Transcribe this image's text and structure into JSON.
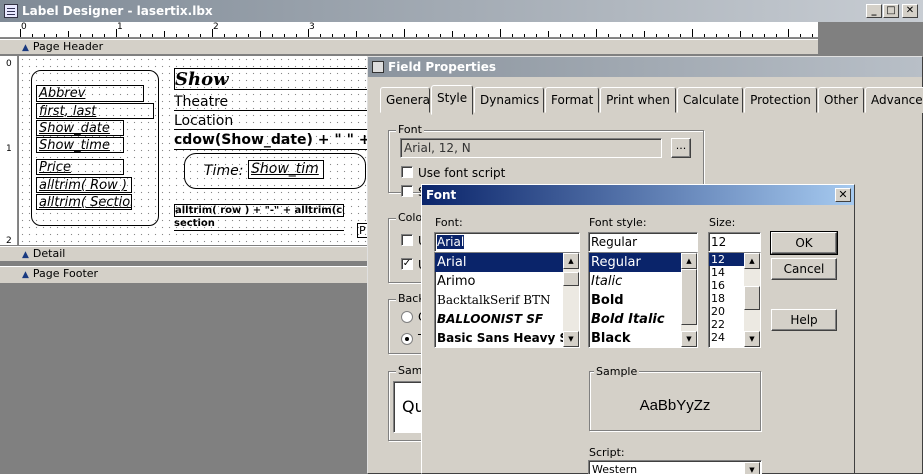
{
  "window": {
    "title": "Label Designer - lasertix.lbx",
    "min_glyph": "_",
    "max_glyph": "□",
    "close_glyph": "✕"
  },
  "ruler": {
    "marks": [
      "0",
      "1",
      "2",
      "3"
    ]
  },
  "vruler": {
    "marks": [
      "0",
      "1",
      "2"
    ]
  },
  "bands": {
    "header": "Page Header",
    "detail": "Detail",
    "footer": "Page Footer"
  },
  "label": {
    "fields_left": [
      "Abbrev",
      "first, last",
      "Show_date",
      "Show_time",
      "Price",
      "alltrim( Row )",
      "alltrim( Section"
    ],
    "show": "Show",
    "theatre": "Theatre",
    "location": "Location",
    "cdow": "cdow(Show_date) + \" \" +",
    "time_label": "Time:",
    "show_time": "Show_tim",
    "row_expr": "alltrim( row ) + \"-\" + alltrim(colu",
    "section": "section",
    "p_mark": "P"
  },
  "field_properties": {
    "title": "Field Properties",
    "tabs": [
      "General",
      "Style",
      "Dynamics",
      "Format",
      "Print when",
      "Calculate",
      "Protection",
      "Other",
      "Advanced"
    ],
    "selected_tab": "Style",
    "font_group": "Font",
    "font_value": "Arial, 12, N",
    "font_button": "...",
    "use_font_script": "Use font script",
    "second_check_partial": "S",
    "color_group_partial": "Colo",
    "color_check1_partial": "U",
    "color_check2_partial": "U",
    "back_group_partial": "Back",
    "back_radio1_partial": "C",
    "back_radio2_partial": "T",
    "sample_group_partial": "Sam",
    "sample_text_partial": "Qu"
  },
  "font_dialog": {
    "title": "Font",
    "close": "✕",
    "font_label": "Font:",
    "font_input": "Arial",
    "fonts": [
      "Arial",
      "Arimo",
      "BacktalkSerif BTN",
      "BALLOONIST SF",
      "Basic Sans Heavy SF"
    ],
    "style_label": "Font style:",
    "style_input": "Regular",
    "styles": [
      "Regular",
      "Italic",
      "Bold",
      "Bold Italic",
      "Black"
    ],
    "size_label": "Size:",
    "size_input": "12",
    "sizes": [
      "12",
      "14",
      "16",
      "18",
      "20",
      "22",
      "24"
    ],
    "ok": "OK",
    "cancel": "Cancel",
    "help": "Help",
    "sample_label": "Sample",
    "sample_text": "AaBbYyZz",
    "script_label": "Script:",
    "script_value": "Western"
  }
}
